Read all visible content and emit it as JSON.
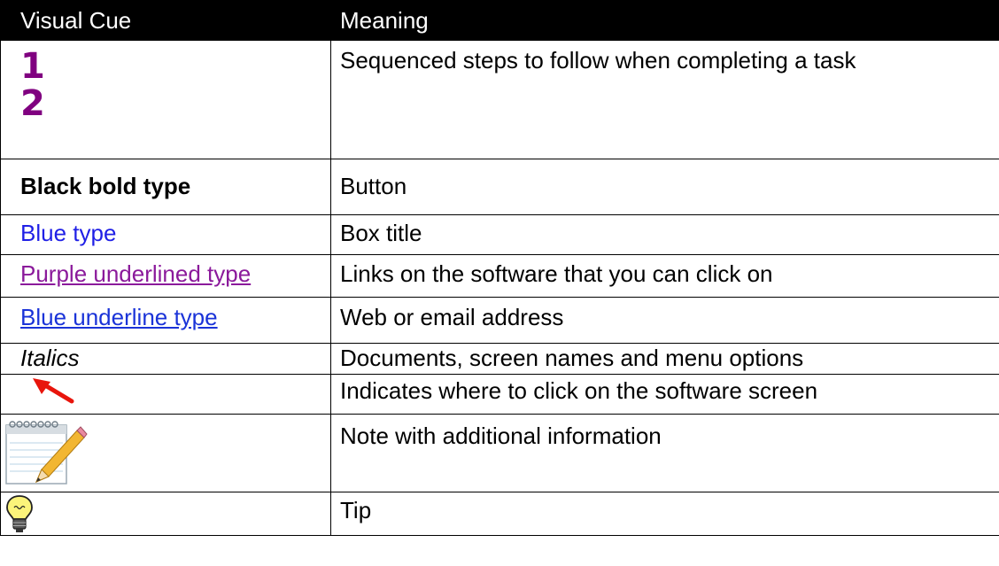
{
  "header": {
    "visual_cue": "Visual Cue",
    "meaning": "Meaning"
  },
  "rows": [
    {
      "cue": "",
      "meaning": "Sequenced steps to follow when completing a task",
      "steps": [
        "1",
        "2"
      ]
    },
    {
      "cue": "Black bold type",
      "meaning": "Button"
    },
    {
      "cue": "Blue type",
      "meaning": "Box title"
    },
    {
      "cue": "Purple underlined type",
      "meaning": "Links on the software that you can click on"
    },
    {
      "cue": "Blue underline type",
      "meaning": "Web or email address"
    },
    {
      "cue": "Italics",
      "meaning": "Documents,  screen names and menu options"
    },
    {
      "cue": "",
      "meaning": "Indicates where to click on the software screen",
      "icon": "red-arrow-icon"
    },
    {
      "cue": "",
      "meaning": "Note with additional information",
      "icon": "notepad-pencil-icon"
    },
    {
      "cue": "",
      "meaning": "Tip",
      "icon": "lightbulb-icon"
    }
  ],
  "colors": {
    "step_number": "#800080",
    "blue_type": "#1f1fe6",
    "purple_link": "#8b1a9b",
    "blue_link": "#1a33d8",
    "arrow": "#e8150c"
  }
}
